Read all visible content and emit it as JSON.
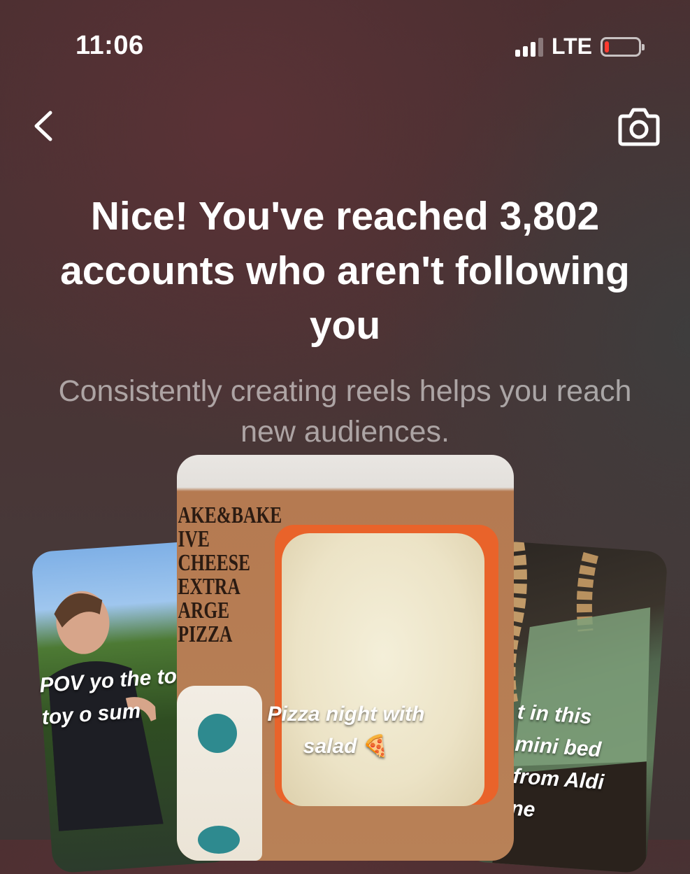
{
  "status_bar": {
    "time": "11:06",
    "network": "LTE",
    "battery_level": 0.1,
    "battery_color": "#ff3b30"
  },
  "nav": {
    "back_icon": "chevron-left-icon",
    "camera_icon": "camera-icon"
  },
  "headline": "Nice! You've reached 3,802 accounts who aren't following you",
  "subtext": "Consistently creating reels helps you reach new audiences.",
  "reels": [
    {
      "caption": "POV yo the to toy o sum"
    },
    {
      "caption_line1": "Pizza night with",
      "caption_line2": "salad",
      "emoji": "🍕"
    },
    {
      "caption": "t in this mini bed from Aldi ne"
    }
  ],
  "pizza_box": {
    "label_lines": [
      "AKE&BAKE",
      "IVE CHEESE",
      "EXTRA",
      "ARGE",
      "PIZZA"
    ]
  }
}
